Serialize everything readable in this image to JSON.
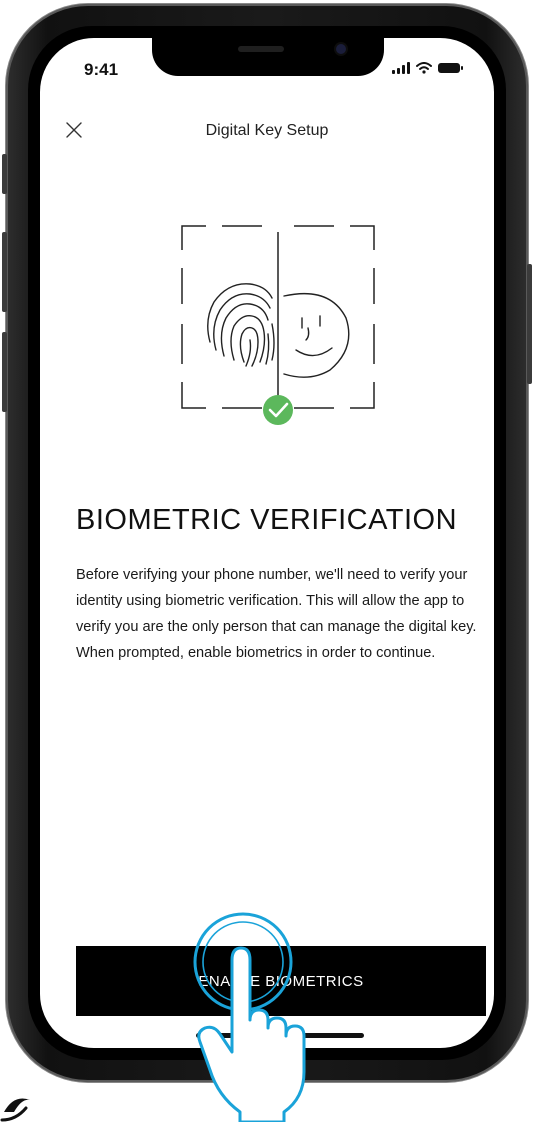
{
  "status_bar": {
    "time": "9:41"
  },
  "nav": {
    "title": "Digital Key Setup",
    "close_icon": "close-icon"
  },
  "illustration": {
    "icons": [
      "fingerprint-icon",
      "face-icon",
      "check-icon"
    ],
    "check_color": "#5cb85c"
  },
  "content": {
    "heading": "BIOMETRIC VERIFICATION",
    "body": "Before verifying your phone number, we'll need to verify your identity using biometric verification. This will allow the app to verify you are the only person that can manage the digital key. When prompted, enable biometrics in order to continue."
  },
  "action": {
    "button_label": "ENABLE BIOMETRICS"
  },
  "overlay": {
    "icon": "tap-hand-icon"
  },
  "colors": {
    "button_bg": "#000000",
    "button_text": "#ffffff",
    "tap_ring": "#1aa3d9"
  }
}
